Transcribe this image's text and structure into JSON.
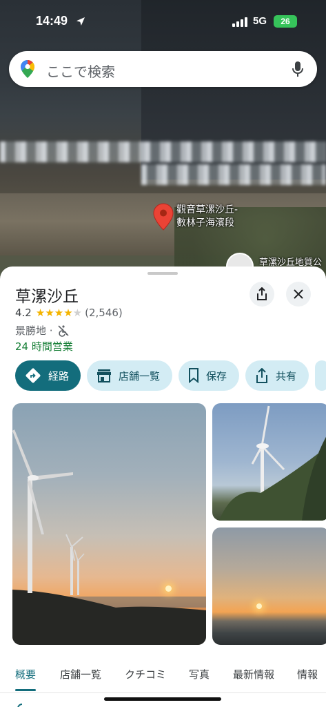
{
  "status_bar": {
    "time": "14:49",
    "network": "5G",
    "battery": "26",
    "location_icon": "location-arrow-icon",
    "signal_icon": "signal-bars-icon"
  },
  "search": {
    "placeholder": "ここで検索",
    "logo_icon": "google-maps-pin-icon",
    "mic_icon": "microphone-icon"
  },
  "map": {
    "marker_label_line1": "觀音草漯沙丘-",
    "marker_label_line2": "數林子海濱段",
    "poi_label": "草漯沙丘地質公",
    "marker_color": "#ea4335"
  },
  "place": {
    "title": "草漯沙丘",
    "rating": "4.2",
    "stars": [
      1,
      1,
      1,
      1,
      0
    ],
    "review_count": "(2,546)",
    "category": "景勝地 ·",
    "accessibility_icon": "no-wheelchair-icon",
    "hours": "24 時間営業",
    "hours_color": "#188038"
  },
  "actions": [
    {
      "label": "経路",
      "icon": "directions-icon"
    },
    {
      "label": "店舗一覧",
      "icon": "store-icon"
    },
    {
      "label": "保存",
      "icon": "bookmark-icon"
    },
    {
      "label": "共有",
      "icon": "share-icon"
    }
  ],
  "accent_color": "#136d7c",
  "tabs": [
    "概要",
    "店舗一覧",
    "クチコミ",
    "写真",
    "最新情報",
    "情報"
  ],
  "active_tab": "概要"
}
